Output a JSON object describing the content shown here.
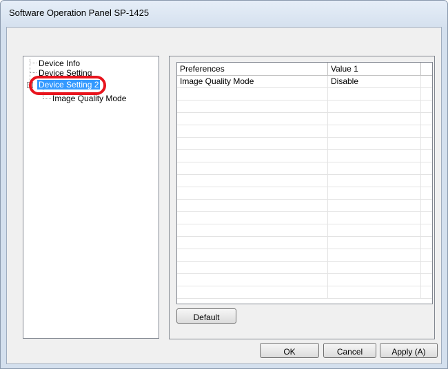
{
  "window": {
    "title": "Software Operation Panel SP-1425"
  },
  "tree": {
    "items": [
      {
        "label": "Device Info"
      },
      {
        "label": "Device Setting"
      },
      {
        "label": "Device Setting 2",
        "selected": true
      },
      {
        "label": "Image Quality Mode"
      }
    ]
  },
  "table": {
    "columns": [
      "Preferences",
      "Value 1"
    ],
    "rows": [
      [
        "Image Quality Mode",
        "Disable"
      ]
    ]
  },
  "buttons": {
    "default_label": "Default",
    "ok_label": "OK",
    "cancel_label": "Cancel",
    "apply_label": "Apply (A)"
  },
  "colors": {
    "selection": "#3399ff",
    "highlight_ring": "#e8141d"
  }
}
